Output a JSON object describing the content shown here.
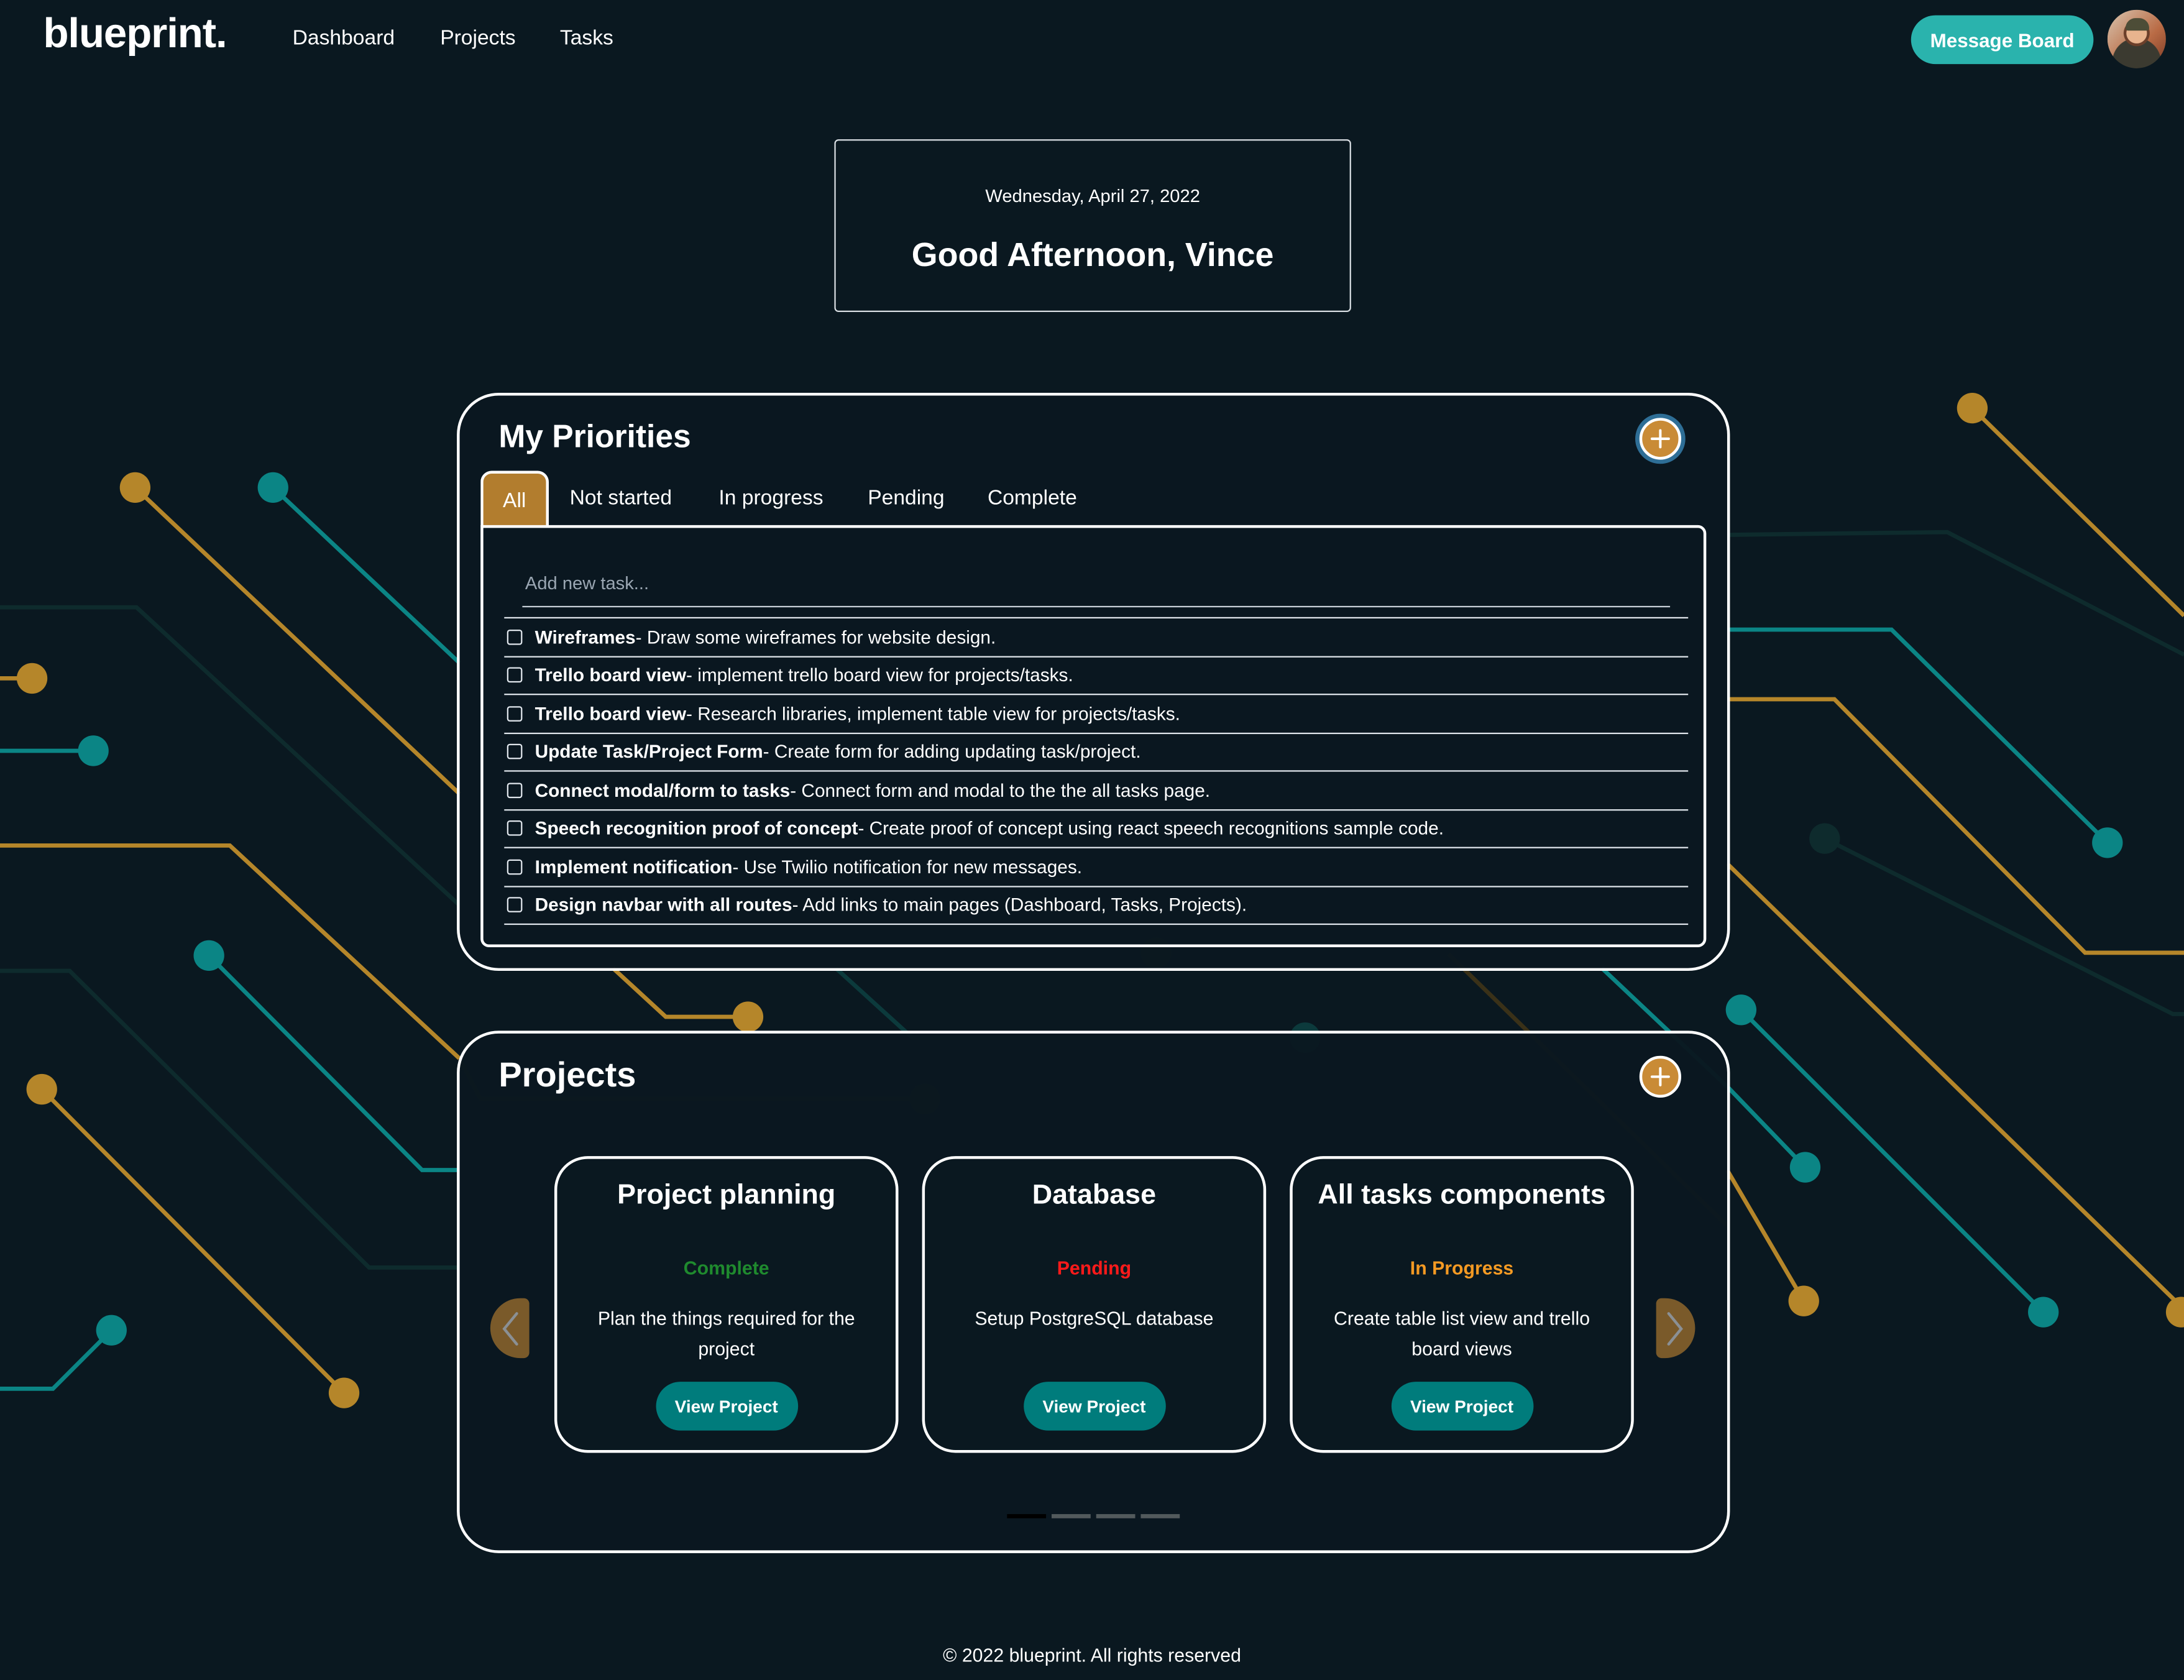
{
  "nav": {
    "logo": "blueprint.",
    "links": [
      "Dashboard",
      "Projects",
      "Tasks"
    ],
    "message_board_label": "Message Board",
    "avatar_alt": "User avatar"
  },
  "greeting": {
    "date": "Wednesday, April 27, 2022",
    "title": "Good Afternoon, Vince"
  },
  "priorities": {
    "title": "My Priorities",
    "add_icon": "plus-icon",
    "tabs": [
      {
        "label": "All",
        "active": true
      },
      {
        "label": "Not started",
        "active": false
      },
      {
        "label": "In progress",
        "active": false
      },
      {
        "label": "Pending",
        "active": false
      },
      {
        "label": "Complete",
        "active": false
      }
    ],
    "input_placeholder": "Add new task...",
    "input_value": "",
    "tasks": [
      {
        "name": "Wireframes",
        "desc": " - Draw some wireframes for website design.",
        "checked": false
      },
      {
        "name": "Trello board view",
        "desc": " - implement trello board view for projects/tasks.",
        "checked": false
      },
      {
        "name": "Trello board view",
        "desc": " - Research libraries, implement table view for projects/tasks.",
        "checked": false
      },
      {
        "name": "Update Task/Project Form",
        "desc": " - Create form for adding updating task/project.",
        "checked": false
      },
      {
        "name": "Connect modal/form to tasks",
        "desc": " - Connect form and modal to the the all tasks page.",
        "checked": false
      },
      {
        "name": "Speech recognition proof of concept",
        "desc": " - Create proof of concept using react speech recognitions sample code.",
        "checked": false
      },
      {
        "name": "Implement notification",
        "desc": " - Use Twilio notification for new messages.",
        "checked": false
      },
      {
        "name": "Design navbar with all routes",
        "desc": " - Add links to main pages (Dashboard, Tasks, Projects).",
        "checked": false
      }
    ]
  },
  "projects": {
    "title": "Projects",
    "add_icon": "plus-icon",
    "cards": [
      {
        "title": "Project planning",
        "status": "Complete",
        "status_color": "#1f8a2e",
        "desc": "Plan the things required for the project",
        "button": "View Project"
      },
      {
        "title": "Database",
        "status": "Pending",
        "status_color": "#ff1a1a",
        "desc": "Setup PostgreSQL database",
        "button": "View Project"
      },
      {
        "title": "All tasks components",
        "status": "In Progress",
        "status_color": "#f59a23",
        "desc": "Create table list view and trello board views",
        "button": "View Project"
      }
    ],
    "prev_icon": "chevron-left-icon",
    "next_icon": "chevron-right-icon",
    "carousel_pages": 4,
    "carousel_active_page": 1
  },
  "footer": {
    "text": "© 2022 blueprint. All rights reserved"
  },
  "colors": {
    "background": "#0a1820",
    "accent_gold": "#c98b36",
    "accent_teal": "#2ab3ad",
    "button_teal": "#007c7c"
  }
}
